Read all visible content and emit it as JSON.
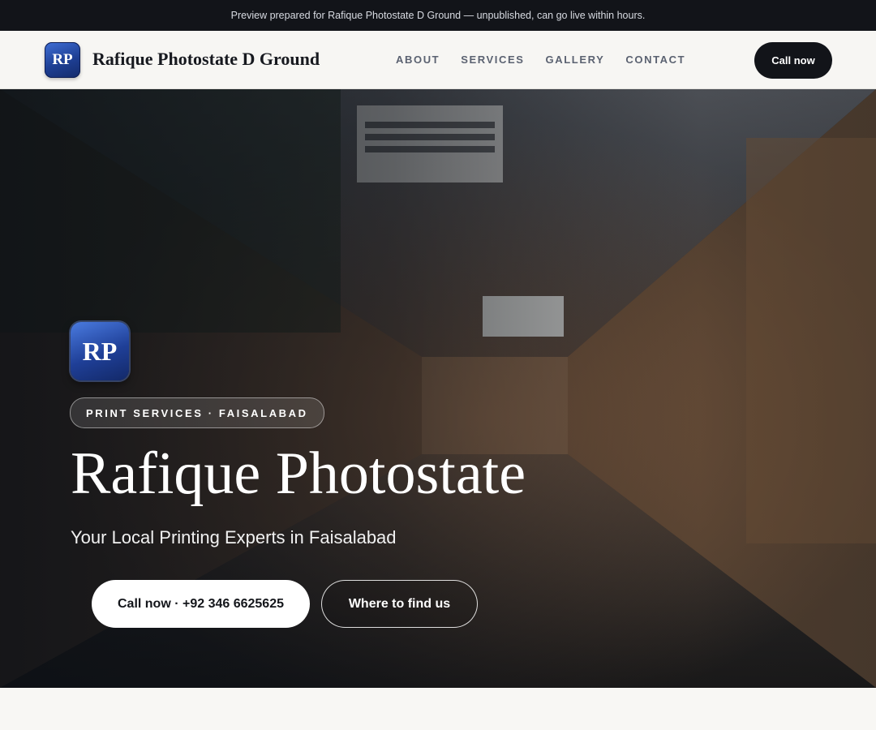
{
  "banner": {
    "text": "Preview prepared for Rafique Photostate D Ground — unpublished, can go live within hours."
  },
  "header": {
    "logo_initials": "RP",
    "brand_name": "Rafique Photostate D Ground",
    "nav": [
      {
        "label": "ABOUT"
      },
      {
        "label": "SERVICES"
      },
      {
        "label": "GALLERY"
      },
      {
        "label": "CONTACT"
      }
    ],
    "cta_label": "Call now"
  },
  "hero": {
    "badge_initials": "RP",
    "eyebrow": "PRINT SERVICES · FAISALABAD",
    "title": "Rafique Photostate",
    "subtitle": "Your Local Printing Experts in Faisalabad",
    "primary_button": "Call now · +92 346 6625625",
    "secondary_button": "Where to find us"
  },
  "colors": {
    "banner_bg": "#121419",
    "logo_blue": "#1e3f94",
    "nav_text": "#5b6271",
    "cta_bg": "#121419",
    "page_bg": "#f8f7f4"
  }
}
